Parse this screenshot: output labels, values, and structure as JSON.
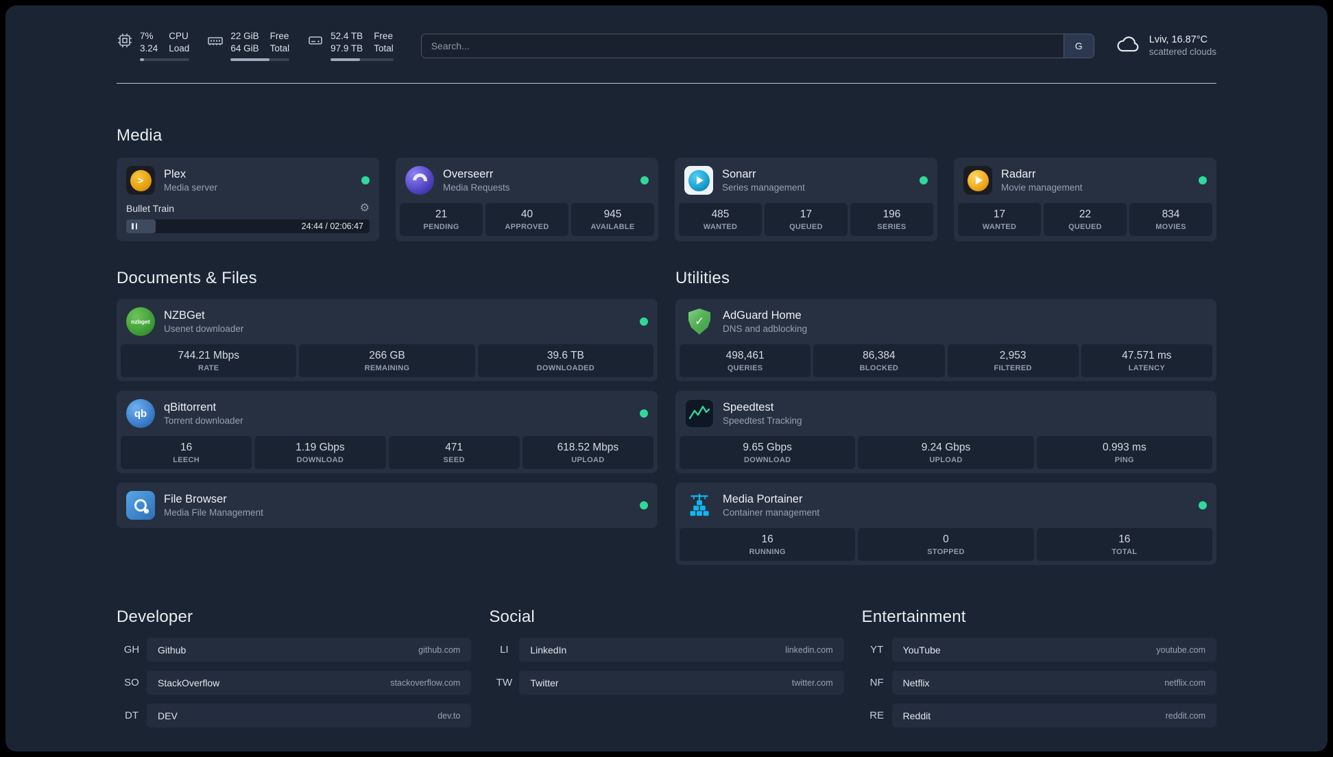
{
  "topbar": {
    "metrics": [
      {
        "icon": "cpu-icon",
        "value": "7%",
        "value2": "3.24",
        "label": "CPU",
        "label2": "Load",
        "progress": 8
      },
      {
        "icon": "memory-icon",
        "value": "22 GiB",
        "value2": "64 GiB",
        "label": "Free",
        "label2": "Total",
        "progress": 66
      },
      {
        "icon": "disk-icon",
        "value": "52.4 TB",
        "value2": "97.9 TB",
        "label": "Free",
        "label2": "Total",
        "progress": 47
      }
    ],
    "search": {
      "placeholder": "Search...",
      "provider_button": "G"
    },
    "weather": {
      "icon": "cloud-icon",
      "location": "Lviv, 16.87°C",
      "condition": "scattered clouds"
    }
  },
  "sections": {
    "media": {
      "title": "Media",
      "plex": {
        "name": "Plex",
        "desc": "Media server",
        "online": true,
        "player_title": "Bullet Train",
        "player_time": "24:44 / 02:06:47",
        "player_progress": 12
      },
      "overseerr": {
        "name": "Overseerr",
        "desc": "Media Requests",
        "online": true,
        "stats": [
          {
            "v": "21",
            "l": "PENDING"
          },
          {
            "v": "40",
            "l": "APPROVED"
          },
          {
            "v": "945",
            "l": "AVAILABLE"
          }
        ]
      },
      "sonarr": {
        "name": "Sonarr",
        "desc": "Series management",
        "online": true,
        "stats": [
          {
            "v": "485",
            "l": "WANTED"
          },
          {
            "v": "17",
            "l": "QUEUED"
          },
          {
            "v": "196",
            "l": "SERIES"
          }
        ]
      },
      "radarr": {
        "name": "Radarr",
        "desc": "Movie management",
        "online": true,
        "stats": [
          {
            "v": "17",
            "l": "WANTED"
          },
          {
            "v": "22",
            "l": "QUEUED"
          },
          {
            "v": "834",
            "l": "MOVIES"
          }
        ]
      }
    },
    "documents": {
      "title": "Documents & Files",
      "nzbget": {
        "name": "NZBGet",
        "desc": "Usenet downloader",
        "icon_text": "nzbget",
        "online": true,
        "stats": [
          {
            "v": "744.21 Mbps",
            "l": "RATE"
          },
          {
            "v": "266 GB",
            "l": "REMAINING"
          },
          {
            "v": "39.6 TB",
            "l": "DOWNLOADED"
          }
        ]
      },
      "qbittorrent": {
        "name": "qBittorrent",
        "desc": "Torrent downloader",
        "icon_text": "qb",
        "online": true,
        "stats": [
          {
            "v": "16",
            "l": "LEECH"
          },
          {
            "v": "1.19 Gbps",
            "l": "DOWNLOAD"
          },
          {
            "v": "471",
            "l": "SEED"
          },
          {
            "v": "618.52 Mbps",
            "l": "UPLOAD"
          }
        ]
      },
      "filebrowser": {
        "name": "File Browser",
        "desc": "Media File Management",
        "online": true
      }
    },
    "utilities": {
      "title": "Utilities",
      "adguard": {
        "name": "AdGuard Home",
        "desc": "DNS and adblocking",
        "stats": [
          {
            "v": "498,461",
            "l": "QUERIES"
          },
          {
            "v": "86,384",
            "l": "BLOCKED"
          },
          {
            "v": "2,953",
            "l": "FILTERED"
          },
          {
            "v": "47.571 ms",
            "l": "LATENCY"
          }
        ]
      },
      "speedtest": {
        "name": "Speedtest",
        "desc": "Speedtest Tracking",
        "stats": [
          {
            "v": "9.65 Gbps",
            "l": "DOWNLOAD"
          },
          {
            "v": "9.24 Gbps",
            "l": "UPLOAD"
          },
          {
            "v": "0.993 ms",
            "l": "PING"
          }
        ]
      },
      "portainer": {
        "name": "Media Portainer",
        "desc": "Container management",
        "online": true,
        "stats": [
          {
            "v": "16",
            "l": "RUNNING"
          },
          {
            "v": "0",
            "l": "STOPPED"
          },
          {
            "v": "16",
            "l": "TOTAL"
          }
        ]
      }
    }
  },
  "bookmarks": {
    "developer": {
      "title": "Developer",
      "items": [
        {
          "abbr": "GH",
          "name": "Github",
          "url": "github.com"
        },
        {
          "abbr": "SO",
          "name": "StackOverflow",
          "url": "stackoverflow.com"
        },
        {
          "abbr": "DT",
          "name": "DEV",
          "url": "dev.to"
        }
      ]
    },
    "social": {
      "title": "Social",
      "items": [
        {
          "abbr": "LI",
          "name": "LinkedIn",
          "url": "linkedin.com"
        },
        {
          "abbr": "TW",
          "name": "Twitter",
          "url": "twitter.com"
        }
      ]
    },
    "entertainment": {
      "title": "Entertainment",
      "items": [
        {
          "abbr": "YT",
          "name": "YouTube",
          "url": "youtube.com"
        },
        {
          "abbr": "NF",
          "name": "Netflix",
          "url": "netflix.com"
        },
        {
          "abbr": "RE",
          "name": "Reddit",
          "url": "reddit.com"
        }
      ]
    }
  },
  "colors": {
    "accent_green": "#30d89a"
  }
}
